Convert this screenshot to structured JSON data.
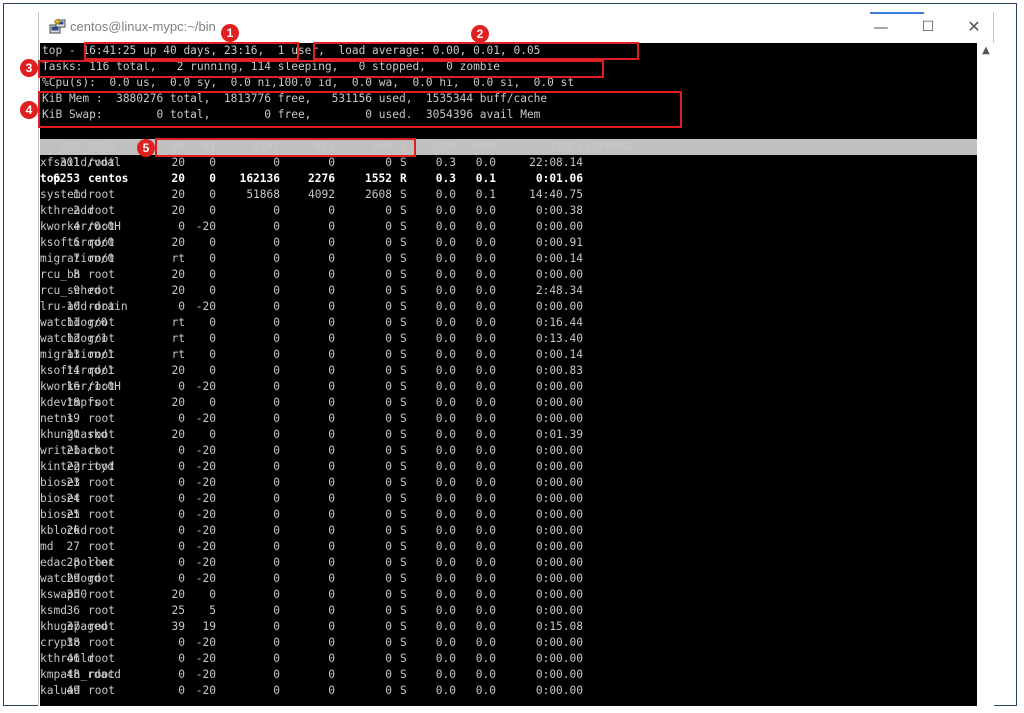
{
  "window": {
    "title": "centos@linux-mypc:~/bin",
    "minimize_glyph": "—",
    "maximize_glyph": "☐",
    "close_glyph": "✕",
    "scroll_up_glyph": "▲"
  },
  "summary": {
    "top_line": "top - 16:41:25 up 40 days, 23:16,  1 user,  load average: 0.00, 0.01, 0.05",
    "tasks_line": "Tasks: 116 total,   2 running, 114 sleeping,   0 stopped,   0 zombie",
    "cpu_line": "%Cpu(s):  0.0 us,  0.0 sy,  0.0 ni,100.0 id,  0.0 wa,  0.0 hi,  0.0 si,  0.0 st",
    "mem_line": "KiB Mem :  3880276 total,  1813776 free,   531156 used,  1535344 buff/cache",
    "swap_line": "KiB Swap:        0 total,        0 free,        0 used.  3054396 avail Mem"
  },
  "columns": {
    "pid": "PID",
    "user": "USER",
    "pr": "PR",
    "ni": "NI",
    "virt": "VIRT",
    "res": "RES",
    "shr": "SHR",
    "s": "S",
    "cpu": "%CPU",
    "mem": "%MEM",
    "time": "TIME+",
    "command": "COMMAND"
  },
  "processes": [
    {
      "pid": "301",
      "user": "root",
      "pr": "20",
      "ni": "0",
      "virt": "0",
      "res": "0",
      "shr": "0",
      "s": "S",
      "cpu": "0.3",
      "mem": "0.0",
      "time": "22:08.14",
      "command": "xfsaild/vdal"
    },
    {
      "pid": "6253",
      "user": "centos",
      "pr": "20",
      "ni": "0",
      "virt": "162136",
      "res": "2276",
      "shr": "1552",
      "s": "R",
      "cpu": "0.3",
      "mem": "0.1",
      "time": "0:01.06",
      "command": "top"
    },
    {
      "pid": "1",
      "user": "root",
      "pr": "20",
      "ni": "0",
      "virt": "51868",
      "res": "4092",
      "shr": "2608",
      "s": "S",
      "cpu": "0.0",
      "mem": "0.1",
      "time": "14:40.75",
      "command": "systemd"
    },
    {
      "pid": "2",
      "user": "root",
      "pr": "20",
      "ni": "0",
      "virt": "0",
      "res": "0",
      "shr": "0",
      "s": "S",
      "cpu": "0.0",
      "mem": "0.0",
      "time": "0:00.38",
      "command": "kthreadd"
    },
    {
      "pid": "4",
      "user": "root",
      "pr": "0",
      "ni": "-20",
      "virt": "0",
      "res": "0",
      "shr": "0",
      "s": "S",
      "cpu": "0.0",
      "mem": "0.0",
      "time": "0:00.00",
      "command": "kworker/0:0H"
    },
    {
      "pid": "6",
      "user": "root",
      "pr": "20",
      "ni": "0",
      "virt": "0",
      "res": "0",
      "shr": "0",
      "s": "S",
      "cpu": "0.0",
      "mem": "0.0",
      "time": "0:00.91",
      "command": "ksoftirqd/0"
    },
    {
      "pid": "7",
      "user": "root",
      "pr": "rt",
      "ni": "0",
      "virt": "0",
      "res": "0",
      "shr": "0",
      "s": "S",
      "cpu": "0.0",
      "mem": "0.0",
      "time": "0:00.14",
      "command": "migration/0"
    },
    {
      "pid": "8",
      "user": "root",
      "pr": "20",
      "ni": "0",
      "virt": "0",
      "res": "0",
      "shr": "0",
      "s": "S",
      "cpu": "0.0",
      "mem": "0.0",
      "time": "0:00.00",
      "command": "rcu_bh"
    },
    {
      "pid": "9",
      "user": "root",
      "pr": "20",
      "ni": "0",
      "virt": "0",
      "res": "0",
      "shr": "0",
      "s": "S",
      "cpu": "0.0",
      "mem": "0.0",
      "time": "2:48.34",
      "command": "rcu_sched"
    },
    {
      "pid": "10",
      "user": "root",
      "pr": "0",
      "ni": "-20",
      "virt": "0",
      "res": "0",
      "shr": "0",
      "s": "S",
      "cpu": "0.0",
      "mem": "0.0",
      "time": "0:00.00",
      "command": "lru-add-drain"
    },
    {
      "pid": "11",
      "user": "root",
      "pr": "rt",
      "ni": "0",
      "virt": "0",
      "res": "0",
      "shr": "0",
      "s": "S",
      "cpu": "0.0",
      "mem": "0.0",
      "time": "0:16.44",
      "command": "watchdog/0"
    },
    {
      "pid": "12",
      "user": "root",
      "pr": "rt",
      "ni": "0",
      "virt": "0",
      "res": "0",
      "shr": "0",
      "s": "S",
      "cpu": "0.0",
      "mem": "0.0",
      "time": "0:13.40",
      "command": "watchdog/1"
    },
    {
      "pid": "13",
      "user": "root",
      "pr": "rt",
      "ni": "0",
      "virt": "0",
      "res": "0",
      "shr": "0",
      "s": "S",
      "cpu": "0.0",
      "mem": "0.0",
      "time": "0:00.14",
      "command": "migration/1"
    },
    {
      "pid": "14",
      "user": "root",
      "pr": "20",
      "ni": "0",
      "virt": "0",
      "res": "0",
      "shr": "0",
      "s": "S",
      "cpu": "0.0",
      "mem": "0.0",
      "time": "0:00.83",
      "command": "ksoftirqd/1"
    },
    {
      "pid": "16",
      "user": "root",
      "pr": "0",
      "ni": "-20",
      "virt": "0",
      "res": "0",
      "shr": "0",
      "s": "S",
      "cpu": "0.0",
      "mem": "0.0",
      "time": "0:00.00",
      "command": "kworker/1:0H"
    },
    {
      "pid": "18",
      "user": "root",
      "pr": "20",
      "ni": "0",
      "virt": "0",
      "res": "0",
      "shr": "0",
      "s": "S",
      "cpu": "0.0",
      "mem": "0.0",
      "time": "0:00.00",
      "command": "kdevtmpfs"
    },
    {
      "pid": "19",
      "user": "root",
      "pr": "0",
      "ni": "-20",
      "virt": "0",
      "res": "0",
      "shr": "0",
      "s": "S",
      "cpu": "0.0",
      "mem": "0.0",
      "time": "0:00.00",
      "command": "netns"
    },
    {
      "pid": "20",
      "user": "root",
      "pr": "20",
      "ni": "0",
      "virt": "0",
      "res": "0",
      "shr": "0",
      "s": "S",
      "cpu": "0.0",
      "mem": "0.0",
      "time": "0:01.39",
      "command": "khungtaskd"
    },
    {
      "pid": "21",
      "user": "root",
      "pr": "0",
      "ni": "-20",
      "virt": "0",
      "res": "0",
      "shr": "0",
      "s": "S",
      "cpu": "0.0",
      "mem": "0.0",
      "time": "0:00.00",
      "command": "writeback"
    },
    {
      "pid": "22",
      "user": "root",
      "pr": "0",
      "ni": "-20",
      "virt": "0",
      "res": "0",
      "shr": "0",
      "s": "S",
      "cpu": "0.0",
      "mem": "0.0",
      "time": "0:00.00",
      "command": "kintegrityd"
    },
    {
      "pid": "23",
      "user": "root",
      "pr": "0",
      "ni": "-20",
      "virt": "0",
      "res": "0",
      "shr": "0",
      "s": "S",
      "cpu": "0.0",
      "mem": "0.0",
      "time": "0:00.00",
      "command": "bioset"
    },
    {
      "pid": "24",
      "user": "root",
      "pr": "0",
      "ni": "-20",
      "virt": "0",
      "res": "0",
      "shr": "0",
      "s": "S",
      "cpu": "0.0",
      "mem": "0.0",
      "time": "0:00.00",
      "command": "bioset"
    },
    {
      "pid": "25",
      "user": "root",
      "pr": "0",
      "ni": "-20",
      "virt": "0",
      "res": "0",
      "shr": "0",
      "s": "S",
      "cpu": "0.0",
      "mem": "0.0",
      "time": "0:00.00",
      "command": "bioset"
    },
    {
      "pid": "26",
      "user": "root",
      "pr": "0",
      "ni": "-20",
      "virt": "0",
      "res": "0",
      "shr": "0",
      "s": "S",
      "cpu": "0.0",
      "mem": "0.0",
      "time": "0:00.00",
      "command": "kblockd"
    },
    {
      "pid": "27",
      "user": "root",
      "pr": "0",
      "ni": "-20",
      "virt": "0",
      "res": "0",
      "shr": "0",
      "s": "S",
      "cpu": "0.0",
      "mem": "0.0",
      "time": "0:00.00",
      "command": "md"
    },
    {
      "pid": "28",
      "user": "root",
      "pr": "0",
      "ni": "-20",
      "virt": "0",
      "res": "0",
      "shr": "0",
      "s": "S",
      "cpu": "0.0",
      "mem": "0.0",
      "time": "0:00.00",
      "command": "edac-poller"
    },
    {
      "pid": "29",
      "user": "root",
      "pr": "0",
      "ni": "-20",
      "virt": "0",
      "res": "0",
      "shr": "0",
      "s": "S",
      "cpu": "0.0",
      "mem": "0.0",
      "time": "0:00.00",
      "command": "watchdogd"
    },
    {
      "pid": "35",
      "user": "root",
      "pr": "20",
      "ni": "0",
      "virt": "0",
      "res": "0",
      "shr": "0",
      "s": "S",
      "cpu": "0.0",
      "mem": "0.0",
      "time": "0:00.00",
      "command": "kswapd0"
    },
    {
      "pid": "36",
      "user": "root",
      "pr": "25",
      "ni": "5",
      "virt": "0",
      "res": "0",
      "shr": "0",
      "s": "S",
      "cpu": "0.0",
      "mem": "0.0",
      "time": "0:00.00",
      "command": "ksmd"
    },
    {
      "pid": "37",
      "user": "root",
      "pr": "39",
      "ni": "19",
      "virt": "0",
      "res": "0",
      "shr": "0",
      "s": "S",
      "cpu": "0.0",
      "mem": "0.0",
      "time": "0:15.08",
      "command": "khugepaged"
    },
    {
      "pid": "38",
      "user": "root",
      "pr": "0",
      "ni": "-20",
      "virt": "0",
      "res": "0",
      "shr": "0",
      "s": "S",
      "cpu": "0.0",
      "mem": "0.0",
      "time": "0:00.00",
      "command": "crypto"
    },
    {
      "pid": "46",
      "user": "root",
      "pr": "0",
      "ni": "-20",
      "virt": "0",
      "res": "0",
      "shr": "0",
      "s": "S",
      "cpu": "0.0",
      "mem": "0.0",
      "time": "0:00.00",
      "command": "kthrotld"
    },
    {
      "pid": "48",
      "user": "root",
      "pr": "0",
      "ni": "-20",
      "virt": "0",
      "res": "0",
      "shr": "0",
      "s": "S",
      "cpu": "0.0",
      "mem": "0.0",
      "time": "0:00.00",
      "command": "kmpath_rdacd"
    },
    {
      "pid": "49",
      "user": "root",
      "pr": "0",
      "ni": "-20",
      "virt": "0",
      "res": "0",
      "shr": "0",
      "s": "S",
      "cpu": "0.0",
      "mem": "0.0",
      "time": "0:00.00",
      "command": "kaluad"
    }
  ],
  "annotations": [
    "1",
    "2",
    "3",
    "4",
    "5"
  ],
  "colors": {
    "annotation_red": "#e02020",
    "terminal_bg": "#000000",
    "terminal_fg": "#c8c8c8",
    "header_bar": "#c0c0c0",
    "window_accent": "#3c7bd9"
  }
}
